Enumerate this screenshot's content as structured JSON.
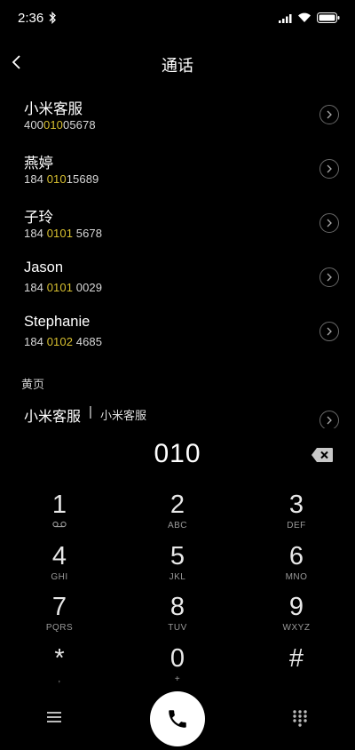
{
  "status": {
    "time": "2:36"
  },
  "header": {
    "title": "通话"
  },
  "contacts": [
    {
      "name": "小米客服",
      "number_parts": [
        "400",
        "010",
        "05678"
      ]
    },
    {
      "name": "燕婷",
      "number_parts": [
        "184 ",
        "010",
        "15689"
      ]
    },
    {
      "name": "子玲",
      "number_parts": [
        "184 ",
        "0101",
        " 5678"
      ]
    },
    {
      "name": "Jason",
      "number_parts": [
        "184 ",
        "0101",
        " 0029"
      ]
    },
    {
      "name": "Stephanie",
      "number_parts": [
        "184 ",
        "0102",
        " 4685"
      ]
    }
  ],
  "yellow_pages": {
    "label": "黄页",
    "item": {
      "name": "小米客服",
      "separator": "|",
      "desc": "小米客服"
    }
  },
  "dialpad": {
    "display": "010",
    "keys": [
      {
        "digit": "1",
        "letters": ""
      },
      {
        "digit": "2",
        "letters": "ABC"
      },
      {
        "digit": "3",
        "letters": "DEF"
      },
      {
        "digit": "4",
        "letters": "GHI"
      },
      {
        "digit": "5",
        "letters": "JKL"
      },
      {
        "digit": "6",
        "letters": "MNO"
      },
      {
        "digit": "7",
        "letters": "PQRS"
      },
      {
        "digit": "8",
        "letters": "TUV"
      },
      {
        "digit": "9",
        "letters": "WXYZ"
      },
      {
        "digit": "*",
        "letters": ","
      },
      {
        "digit": "0",
        "letters": "+"
      },
      {
        "digit": "#",
        "letters": ""
      }
    ]
  },
  "icons": {
    "status": [
      "bluetooth-icon",
      "signal-icon",
      "wifi-icon",
      "battery-icon"
    ],
    "back": "chevron-left-icon",
    "detail": "chevron-right-circle-icon",
    "voicemail": "voicemail-icon",
    "backspace": "backspace-icon",
    "menu": "menu-icon",
    "call": "phone-icon",
    "keypad": "keypad-icon"
  },
  "colors": {
    "background": "#000000",
    "highlight": "#d8c030",
    "call_button": "#ffffff"
  }
}
